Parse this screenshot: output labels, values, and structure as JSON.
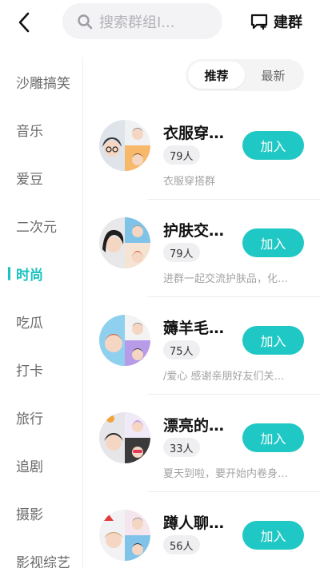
{
  "header": {
    "search_placeholder": "搜索群组I...",
    "create_label": "建群"
  },
  "sidebar": {
    "items": [
      {
        "label": "沙雕搞笑",
        "active": false
      },
      {
        "label": "音乐",
        "active": false
      },
      {
        "label": "爱豆",
        "active": false
      },
      {
        "label": "二次元",
        "active": false
      },
      {
        "label": "时尚",
        "active": true
      },
      {
        "label": "吃瓜",
        "active": false
      },
      {
        "label": "打卡",
        "active": false
      },
      {
        "label": "旅行",
        "active": false
      },
      {
        "label": "追剧",
        "active": false
      },
      {
        "label": "摄影",
        "active": false
      },
      {
        "label": "影视综艺",
        "active": false
      }
    ]
  },
  "tabs": {
    "recommend": "推荐",
    "latest": "最新"
  },
  "groups": [
    {
      "name": "衣服穿…",
      "count": "79人",
      "desc": "衣服穿搭群",
      "join": "加入"
    },
    {
      "name": "护肤交…",
      "count": "79人",
      "desc": "进群一起交流护肤品，化…",
      "join": "加入"
    },
    {
      "name": "薅羊毛…",
      "count": "75人",
      "desc": "/爱心 感谢亲朋好友们关…",
      "join": "加入"
    },
    {
      "name": "漂亮的…",
      "count": "33人",
      "desc": "夏天到啦，要开始内卷身…",
      "join": "加入"
    },
    {
      "name": "蹲人聊…",
      "count": "56人",
      "desc": "",
      "join": "加入"
    }
  ],
  "colors": {
    "accent": "#1fc8c4",
    "active_sidebar": "#19c2c0"
  }
}
